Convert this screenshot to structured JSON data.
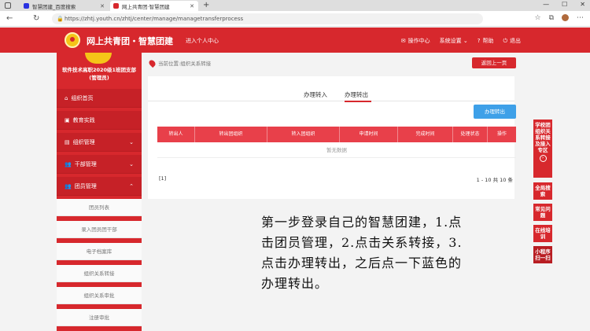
{
  "browser": {
    "tab_inactive": "智慧团建_百度搜索",
    "tab_active": "网上共青团·智慧团建",
    "new_tab": "+",
    "url": "https://zhtj.youth.cn/zhtj/center/manage/managetransferprocess",
    "win_min": "—",
    "win_max": "☐",
    "win_close": "✕",
    "nav_back": "←",
    "nav_refresh": "↻",
    "lock": "🔒"
  },
  "header": {
    "brand": "网上共青团・智慧团建",
    "personal_center": "进入个人中心",
    "nav": [
      {
        "icon": "✉",
        "label": "操作中心"
      },
      {
        "icon": "",
        "label": "系统设置 ⌄"
      },
      {
        "icon": "?",
        "label": "帮助"
      },
      {
        "icon": "⏻",
        "label": "退出"
      }
    ]
  },
  "sidebar": {
    "org_name": "软件技术高职2020级1班团支部",
    "org_role": "(管理员)",
    "menu": [
      {
        "icon": "⌂",
        "label": "组织首页",
        "chevron": ""
      },
      {
        "icon": "▣",
        "label": "教育实践",
        "chevron": ""
      },
      {
        "icon": "▤",
        "label": "组织管理",
        "chevron": "⌄"
      },
      {
        "icon": "👥",
        "label": "干部管理",
        "chevron": "⌄"
      },
      {
        "icon": "👥",
        "label": "团员管理",
        "chevron": "⌃"
      }
    ],
    "submenu": [
      "团员列表",
      "录入团员团干部",
      "电子档案库",
      "组织关系转接",
      "组织关系审批",
      "注册审批"
    ]
  },
  "main": {
    "breadcrumb": "当前位置:组织关系转接",
    "back_button": "返回上一页",
    "tabs": [
      "办理转入",
      "办理转出"
    ],
    "action_button": "办理转出",
    "columns": [
      "转出人",
      "转出团组织",
      "转入团组织",
      "申请时间",
      "完成时间",
      "处理状态",
      "操作"
    ],
    "empty_text": "暂无数据",
    "page_current": "[1]",
    "page_summary": "1 - 10 共 10 条"
  },
  "right_float": [
    {
      "label": "学校团组织关系转接及接入专区",
      "icon": "›"
    },
    {
      "label": "全局搜索",
      "icon": ""
    },
    {
      "label": "常见问题",
      "icon": ""
    },
    {
      "label": "在线培训",
      "icon": ""
    },
    {
      "label": "小程序扫一扫",
      "icon": ""
    }
  ],
  "note": "第一步登录自己的智慧团建，1.点击团员管理，2.点击关系转接，3.点击办理转出，之后点一下蓝色的办理转出。",
  "colors": {
    "primary_red": "#d7282d",
    "table_header": "#e8404a",
    "button_blue": "#3ea0e8",
    "logo_gold": "#f5c518"
  }
}
